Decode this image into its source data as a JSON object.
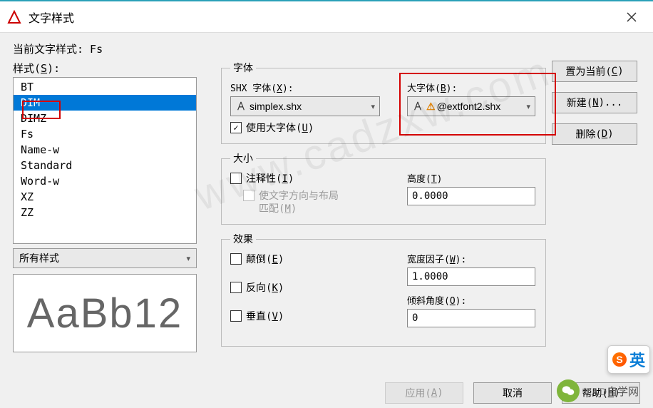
{
  "window": {
    "title": "文字样式"
  },
  "current_style_label": "当前文字样式:  Fs",
  "style_list": {
    "label_html": "样式(<u>S</u>):",
    "items": [
      "BT",
      "DIM",
      "DIMZ",
      "Fs",
      "Name-w",
      "Standard",
      "Word-w",
      "XZ",
      "ZZ"
    ],
    "selected": "DIM"
  },
  "filter": {
    "value": "所有样式"
  },
  "preview_text": "AaBb12",
  "font_group": {
    "legend": "字体",
    "shx_label_html": "SHX 字体(<u>X</u>):",
    "shx_value": "simplex.shx",
    "big_label_html": "大字体(<u>B</u>):",
    "big_value": "@extfont2.shx",
    "use_big_html": "使用大字体(<u>U</u>)",
    "use_big_checked": true
  },
  "size_group": {
    "legend": "大小",
    "annotative_html": "注释性(<u>I</u>)",
    "annotative_checked": false,
    "match_orient_html": "使文字方向与布局<br>匹配(<u>M</u>)",
    "height_label_html": "高度(<u>T</u>)",
    "height_value": "0.0000"
  },
  "effects_group": {
    "legend": "效果",
    "upside_html": "颠倒(<u>E</u>)",
    "backward_html": "反向(<u>K</u>)",
    "vertical_html": "垂直(<u>V</u>)",
    "width_label_html": "宽度因子(<u>W</u>):",
    "width_value": "1.0000",
    "oblique_label_html": "倾斜角度(<u>O</u>):",
    "oblique_value": "0"
  },
  "buttons": {
    "set_current_html": "置为当前(<u>C</u>)",
    "new_html": "新建(<u>N</u>)...",
    "delete_html": "删除(<u>D</u>)",
    "apply_html": "应用(<u>A</u>)",
    "cancel": "取消",
    "help_html": "帮助(<u>H</u>)"
  },
  "ime": {
    "lang": "英"
  },
  "brand": "CAD自学网",
  "watermark": "www.cadzxw.com"
}
